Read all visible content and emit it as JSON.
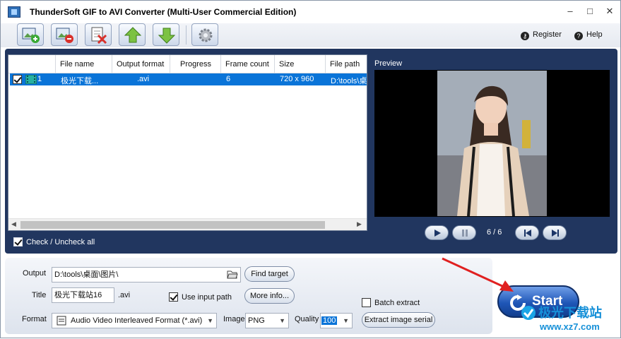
{
  "window": {
    "title": "ThunderSoft GIF to AVI Converter (Multi-User Commercial Edition)",
    "minimize": "–",
    "maximize": "□",
    "close": "✕"
  },
  "toolbar": {
    "buttons": [
      "add-image-icon",
      "remove-image-icon",
      "clear-list-icon",
      "move-up-icon",
      "move-down-icon",
      "settings-gear-icon"
    ],
    "register_label": "Register",
    "help_label": "Help"
  },
  "file_list": {
    "columns": [
      "File name",
      "Output format",
      "Progress",
      "Frame count",
      "Size",
      "File path"
    ],
    "rows": [
      {
        "checked": true,
        "index": "1",
        "file_name": "极光下载...",
        "output_format": ".avi",
        "progress": "",
        "frame_count": "6",
        "size": "720 x 960",
        "file_path": "D:\\tools\\桌"
      }
    ],
    "check_all_label": "Check / Uncheck all",
    "check_all_checked": true
  },
  "preview": {
    "label": "Preview",
    "frame_indicator": "6 / 6"
  },
  "output": {
    "output_label": "Output",
    "output_value": "D:\\tools\\桌面\\图片\\",
    "find_target_label": "Find target",
    "title_label": "Title",
    "title_value": "极光下载站16",
    "title_ext": ".avi",
    "use_input_path_label": "Use input path",
    "use_input_path_checked": true,
    "more_info_label": "More info...",
    "batch_extract_label": "Batch extract",
    "batch_extract_checked": false,
    "format_label": "Format",
    "format_value": "Audio Video Interleaved Format (*.avi)",
    "image_label": "Image",
    "image_value": "PNG",
    "quality_label": "Quality",
    "quality_value": "100",
    "extract_serial_label": "Extract image serial"
  },
  "start": {
    "label": "Start"
  },
  "watermark": {
    "line1": "极光下载站",
    "line2": "www.xz7.com"
  },
  "colors": {
    "band": "#21365f",
    "selection": "#0a74d8",
    "start": "#1f56b7",
    "annotation_arrow": "#e02020"
  }
}
